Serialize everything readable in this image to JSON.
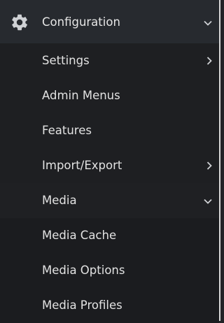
{
  "header": {
    "icon": "gear-icon",
    "label": "Configuration",
    "chevron": "chevron-down-icon"
  },
  "items": [
    {
      "label": "Settings",
      "chevron": "chevron-right-icon"
    },
    {
      "label": "Admin Menus"
    },
    {
      "label": "Features"
    },
    {
      "label": "Import/Export",
      "chevron": "chevron-right-icon"
    },
    {
      "label": "Media",
      "chevron": "chevron-down-icon"
    }
  ],
  "media_items": [
    {
      "label": "Media Cache"
    },
    {
      "label": "Media Options"
    },
    {
      "label": "Media Profiles"
    }
  ],
  "colors": {
    "background": "#222327",
    "header_background": "#272a2f",
    "submenu_background": "#1e1f22",
    "text": "#e3e3e3",
    "edge": "#d7d7d7"
  }
}
